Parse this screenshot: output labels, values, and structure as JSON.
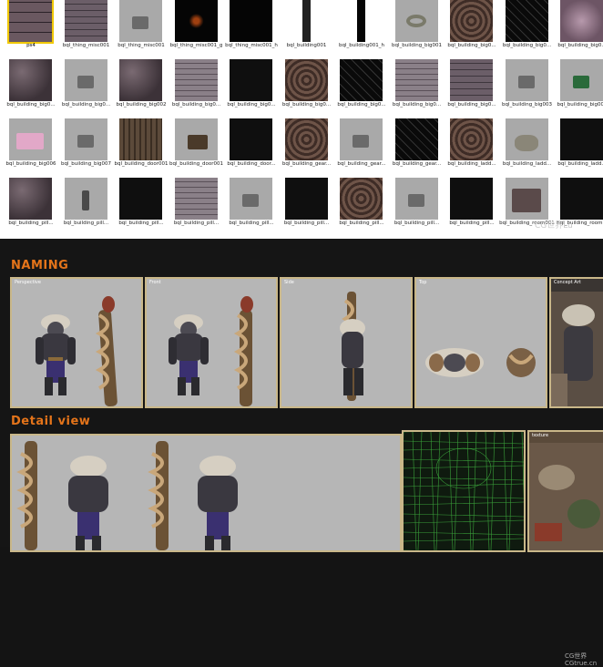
{
  "browser": {
    "rows": [
      [
        {
          "label": "ps4",
          "selected": true,
          "style": "sel-img"
        },
        {
          "label": "bql_thing_misc001",
          "style": "brick"
        },
        {
          "label": "bql_thing_misc001",
          "style": "gray-box"
        },
        {
          "label": "bql_thing_misc001_g",
          "style": "dark-glow"
        },
        {
          "label": "bql_thing_misc001_h",
          "style": "black"
        },
        {
          "label": "bql_building001",
          "style": "bar"
        },
        {
          "label": "bql_building001_h",
          "style": "bar-dark"
        },
        {
          "label": "bql_building_big001",
          "style": "gray-ring"
        },
        {
          "label": "bql_building_big0...",
          "style": "swirl"
        },
        {
          "label": "bql_building_big0...",
          "style": "lines"
        },
        {
          "label": "bql_building_big0...",
          "style": "pink"
        }
      ],
      [
        {
          "label": "bql_building_big0...",
          "style": "stone"
        },
        {
          "label": "bql_building_big0...",
          "style": "gray-obj"
        },
        {
          "label": "bql_building_big002",
          "style": "stone"
        },
        {
          "label": "bql_building_big0...",
          "style": "brick2"
        },
        {
          "label": "bql_building_big0...",
          "style": "dark"
        },
        {
          "label": "bql_building_big0...",
          "style": "swirl"
        },
        {
          "label": "bql_building_big0...",
          "style": "lines"
        },
        {
          "label": "bql_building_big0...",
          "style": "brick2"
        },
        {
          "label": "bql_building_big0...",
          "style": "brick"
        },
        {
          "label": "bql_building_big003",
          "style": "gray-obj"
        },
        {
          "label": "bql_building_big004",
          "style": "gray-box-green"
        }
      ],
      [
        {
          "label": "bql_building_big006",
          "style": "gray-pink"
        },
        {
          "label": "bql_building_big007",
          "style": "gray-obj"
        },
        {
          "label": "bql_building_door001",
          "style": "wood"
        },
        {
          "label": "bql_building_door001",
          "style": "gray-gate"
        },
        {
          "label": "bql_building_door...",
          "style": "dark"
        },
        {
          "label": "bql_building_gear...",
          "style": "swirl"
        },
        {
          "label": "bql_building_gear...",
          "style": "gray-obj"
        },
        {
          "label": "bql_building_gear...",
          "style": "lines"
        },
        {
          "label": "bql_building_ladd...",
          "style": "swirl"
        },
        {
          "label": "bql_building_ladd...",
          "style": "gray-rock"
        },
        {
          "label": "bql_building_ladd...",
          "style": "dark"
        }
      ],
      [
        {
          "label": "bql_building_pill...",
          "style": "stone"
        },
        {
          "label": "bql_building_pill...",
          "style": "gray-pillar"
        },
        {
          "label": "bql_building_pill...",
          "style": "dark"
        },
        {
          "label": "bql_building_pill...",
          "style": "brick2"
        },
        {
          "label": "bql_building_pill...",
          "style": "gray-box"
        },
        {
          "label": "bql_building_pill...",
          "style": "dark"
        },
        {
          "label": "bql_building_pill...",
          "style": "swirl"
        },
        {
          "label": "bql_building_pill...",
          "style": "gray-obj"
        },
        {
          "label": "bql_building_pill...",
          "style": "dark"
        },
        {
          "label": "bql_building_room001",
          "style": "gray-scene"
        },
        {
          "label": "bql_building_room...",
          "style": "dark"
        }
      ]
    ],
    "watermark": "CG世界Lu"
  },
  "sheet": {
    "naming_title": "NAMING",
    "detail_title": "Detail view",
    "panels": {
      "perspective": "Perspective",
      "front": "Front",
      "side": "Side",
      "top": "Top",
      "concept": "Concept Art",
      "texture": "texture"
    },
    "watermark": "CG世界\nCGtrue.cn"
  },
  "colors": {
    "accent": "#e4741a",
    "panel_border": "#c9b789",
    "panel_bg": "#b6b6b6",
    "selection": "#f0c800"
  }
}
